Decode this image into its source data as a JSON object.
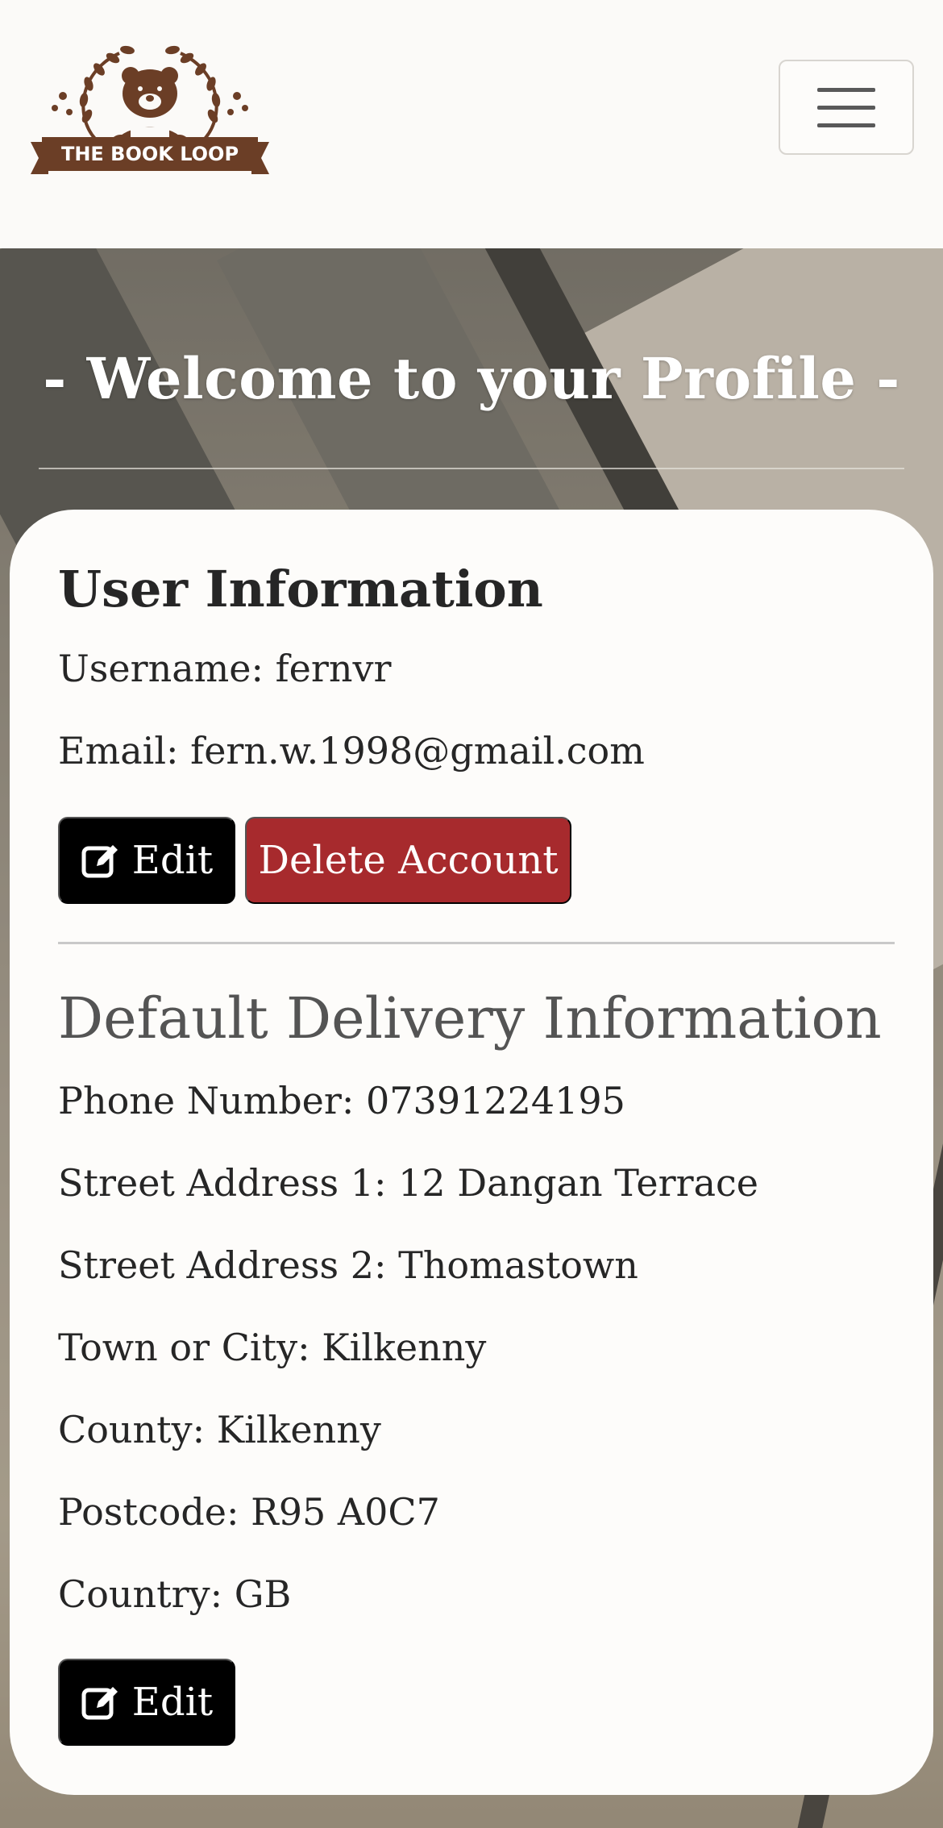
{
  "brand": {
    "logo_text": "THE BOOK LOOP"
  },
  "nav": {
    "toggler_icon": "hamburger-menu-icon"
  },
  "hero": {
    "title": "- Welcome to your Profile -"
  },
  "user_info": {
    "heading": "User Information",
    "username": "Username: fernvr",
    "email": "Email: fern.w.1998@gmail.com",
    "edit_label": "Edit",
    "delete_label": "Delete Account"
  },
  "delivery": {
    "heading": "Default Delivery Information",
    "phone": "Phone Number: 07391224195",
    "street1": "Street Address 1: 12 Dangan Terrace",
    "street2": "Street Address 2: Thomastown",
    "town": "Town or City: Kilkenny",
    "county": "County: Kilkenny",
    "postcode": "Postcode: R95 A0C7",
    "country": "Country: GB",
    "edit_label": "Edit"
  },
  "colors": {
    "brand_brown": "#6b3e26",
    "danger": "#a72a2d",
    "dark": "#000000"
  }
}
